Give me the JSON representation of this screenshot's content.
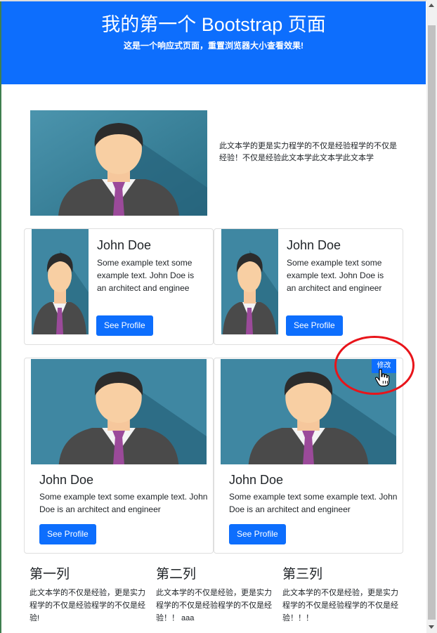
{
  "header": {
    "title": "我的第一个 Bootstrap 页面",
    "subtitle": "这是一个响应式页面，重置浏览器大小查看效果!"
  },
  "intro": {
    "text": "此文本学的更是实力程学的不仅是经验程学的不仅是经验！不仅是经验此文本学此文本学此文本学"
  },
  "profile_cards_small": [
    {
      "name": "John Doe",
      "text": "Some example text some example text. John Doe is an architect and enginee",
      "button": "See Profile"
    },
    {
      "name": "John Doe",
      "text": "Some example text some example text. John Doe is an architect and engineer",
      "button": "See Profile"
    }
  ],
  "profile_cards_large": [
    {
      "name": "John Doe",
      "text": "Some example text some example text. John Doe is an architect and engineer",
      "button": "See Profile"
    },
    {
      "name": "John Doe",
      "text": "Some example text some example text. John Doe is an architect and engineer",
      "button": "See Profile"
    }
  ],
  "edit_button": {
    "label": "修改"
  },
  "columns": [
    {
      "title": "第一列",
      "text": "此文本学的不仅是经验，更是实力程学的不仅是经验程学的不仅是经验!"
    },
    {
      "title": "第二列",
      "text": "此文本学的不仅是经验，更是实力程学的不仅是经验程学的不仅是经验！！ aaa"
    },
    {
      "title": "第三列",
      "text": "此文本学的不仅是经验，更是实力程学的不仅是经验程学的不仅是经验！！！"
    }
  ],
  "colors": {
    "primary": "#0d6efd",
    "highlight_circle": "#e8141a",
    "card_border": "#dfdfdf"
  },
  "icons": [
    "avatar-image",
    "hand-cursor-icon",
    "scroll-up-arrow-icon",
    "scroll-down-arrow-icon"
  ]
}
